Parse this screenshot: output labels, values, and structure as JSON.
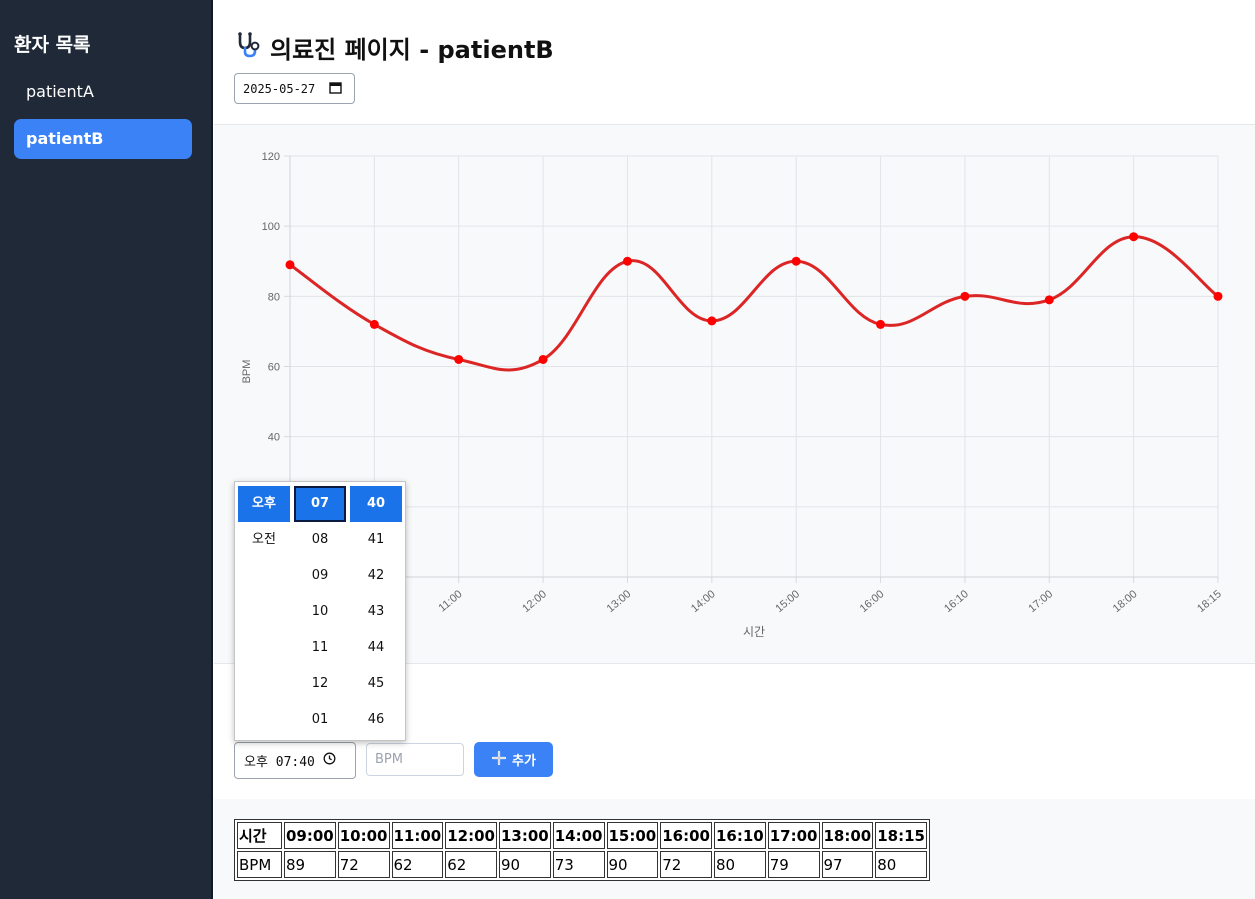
{
  "sidebar": {
    "title": "환자 목록",
    "patients": [
      {
        "label": "patientA",
        "active": false
      },
      {
        "label": "patientB",
        "active": true
      }
    ]
  },
  "header": {
    "title": "의료진 페이지 - patientB",
    "icon": "stethoscope-icon",
    "date_value": "2025-05-27"
  },
  "chart_data": {
    "type": "line",
    "categories": [
      "09:00",
      "10:00",
      "11:00",
      "12:00",
      "13:00",
      "14:00",
      "15:00",
      "16:00",
      "16:10",
      "17:00",
      "18:00",
      "18:15"
    ],
    "series": [
      {
        "values": [
          89,
          72,
          62,
          62,
          90,
          73,
          90,
          72,
          80,
          79,
          97,
          80
        ],
        "color": "#dc2626"
      }
    ],
    "xlabel": "시간",
    "ylabel": "BPM",
    "ylim": [
      0,
      120
    ],
    "yticks": [
      20,
      40,
      60,
      80,
      100,
      120
    ],
    "grid": true,
    "point_color": "#ff0000"
  },
  "form": {
    "time_value": "오후 07:40",
    "bpm_placeholder": "BPM",
    "add_label": "추가"
  },
  "table": {
    "headers": [
      "시간",
      "09:00",
      "10:00",
      "11:00",
      "12:00",
      "13:00",
      "14:00",
      "15:00",
      "16:00",
      "16:10",
      "17:00",
      "18:00",
      "18:15"
    ],
    "row_label": "BPM",
    "values": [
      "89",
      "72",
      "62",
      "62",
      "90",
      "73",
      "90",
      "72",
      "80",
      "79",
      "97",
      "80"
    ]
  },
  "time_picker": {
    "ampm": [
      "오후",
      "오전"
    ],
    "hours": [
      "07",
      "08",
      "09",
      "10",
      "11",
      "12",
      "01"
    ],
    "minutes": [
      "40",
      "41",
      "42",
      "43",
      "44",
      "45",
      "46"
    ],
    "selected": {
      "ampm": "오후",
      "hour": "07",
      "minute": "40"
    }
  },
  "colors": {
    "accent": "#3b82f6",
    "sidebar_bg": "#1f2937",
    "picker_selected": "#1a73e8"
  }
}
